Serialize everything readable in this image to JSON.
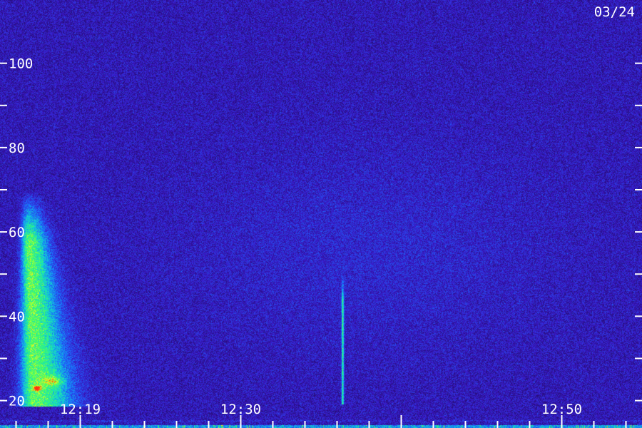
{
  "chart_data": {
    "type": "heatmap",
    "date_label": "03/24",
    "y_axis": {
      "range": [
        13.5,
        115
      ],
      "major_ticks": [
        100,
        80,
        60,
        40,
        20
      ],
      "minor_ticks": [
        90,
        70,
        50,
        30,
        10
      ],
      "tick_labels": [
        "100",
        "80",
        "60",
        "40",
        "20"
      ]
    },
    "x_axis": {
      "range": [
        "12:15",
        "12:55"
      ],
      "major_ticks": [
        "12:20",
        "12:30",
        "12:40",
        "12:50"
      ],
      "tick_labels": [
        "12:19",
        "12:30",
        "12:50"
      ],
      "tick_label_positions": [
        "12:20",
        "12:30",
        "12:50"
      ]
    },
    "colormap": [
      "#1e0a5a",
      "#3a18c8",
      "#1a6cff",
      "#10d8d0",
      "#40ff60",
      "#e8ff20",
      "#ff3010"
    ],
    "features": [
      {
        "name": "burst",
        "time": "12:16:40",
        "freq_low": 20,
        "freq_high": 70,
        "peak_freq": 23
      },
      {
        "name": "spike",
        "time": "12:36:20",
        "freq_low": 20,
        "freq_high": 50
      },
      {
        "name": "band",
        "time_start": "12:15",
        "time_end": "12:55",
        "freq_low": 13.5,
        "freq_high": 20
      }
    ]
  }
}
